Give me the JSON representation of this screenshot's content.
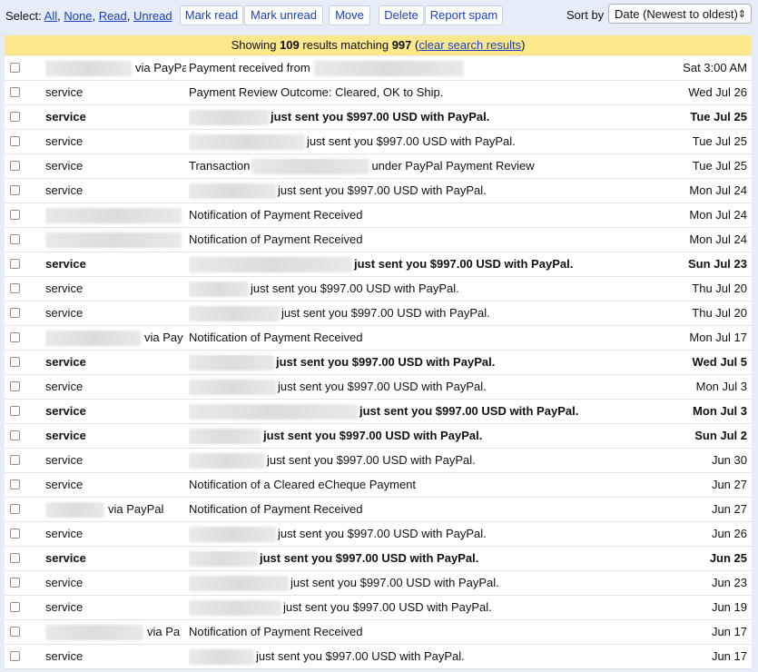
{
  "toolbar": {
    "select_label": "Select:",
    "all": "All",
    "none": "None",
    "read": "Read",
    "unread": "Unread",
    "sep1": ",",
    "sep2": ",",
    "sep3": ",",
    "mark_read": "Mark read",
    "mark_unread": "Mark unread",
    "move": "Move",
    "delete": "Delete",
    "report_spam": "Report spam",
    "sort_label": "Sort by",
    "sort_value": "Date (Newest to oldest)",
    "sort_arrow": "⇕"
  },
  "banner": {
    "showing": "Showing",
    "count": "109",
    "results_matching": "results matching",
    "query": "997",
    "open_paren": "(",
    "clear_link": "clear search results",
    "close_paren": ")"
  },
  "messages": [
    {
      "sender": "via PayPa",
      "subject": "Payment received from",
      "date": "Sat 3:00 AM",
      "bold": false
    },
    {
      "sender": "service",
      "subject": "Payment Review Outcome: Cleared, OK to Ship.",
      "date": "Wed Jul 26",
      "bold": false
    },
    {
      "sender": "service",
      "subject": "just sent you $997.00 USD with PayPal.",
      "date": "Tue Jul 25",
      "bold": true
    },
    {
      "sender": "service",
      "subject": "just sent you $997.00 USD with PayPal.",
      "date": "Tue Jul 25",
      "bold": false
    },
    {
      "sender": "service",
      "subject": "Transaction",
      "subject_after": "under PayPal Payment Review",
      "date": "Tue Jul 25",
      "bold": false
    },
    {
      "sender": "service",
      "subject": "just sent you $997.00 USD with PayPal.",
      "date": "Mon Jul 24",
      "bold": false
    },
    {
      "sender": "",
      "subject": "Notification of Payment Received",
      "date": "Mon Jul 24",
      "bold": false
    },
    {
      "sender": "",
      "subject": "Notification of Payment Received",
      "date": "Mon Jul 24",
      "bold": false
    },
    {
      "sender": "service",
      "subject": "just sent you $997.00 USD with PayPal.",
      "date": "Sun Jul 23",
      "bold": true
    },
    {
      "sender": "service",
      "subject": "just sent you $997.00 USD with PayPal.",
      "date": "Thu Jul 20",
      "bold": false
    },
    {
      "sender": "service",
      "subject": "just sent you $997.00 USD with PayPal.",
      "date": "Thu Jul 20",
      "bold": false
    },
    {
      "sender": "via Pay",
      "subject": "Notification of Payment Received",
      "date": "Mon Jul 17",
      "bold": false
    },
    {
      "sender": "service",
      "subject": "just sent you $997.00 USD with PayPal.",
      "date": "Wed Jul 5",
      "bold": true
    },
    {
      "sender": "service",
      "subject": "just sent you $997.00 USD with PayPal.",
      "date": "Mon Jul 3",
      "bold": false
    },
    {
      "sender": "service",
      "subject": "just sent you $997.00 USD with PayPal.",
      "date": "Mon Jul 3",
      "bold": true
    },
    {
      "sender": "service",
      "subject": "just sent you $997.00 USD with PayPal.",
      "date": "Sun Jul 2",
      "bold": true
    },
    {
      "sender": "service",
      "subject": "just sent you $997.00 USD with PayPal.",
      "date": "Jun 30",
      "bold": false
    },
    {
      "sender": "service",
      "subject": "Notification of a Cleared eCheque Payment",
      "date": "Jun 27",
      "bold": false
    },
    {
      "sender": "via PayPal",
      "subject": "Notification of Payment Received",
      "date": "Jun 27",
      "bold": false
    },
    {
      "sender": "service",
      "subject": "just sent you $997.00 USD with PayPal.",
      "date": "Jun 26",
      "bold": false
    },
    {
      "sender": "service",
      "subject": "just sent you $997.00 USD with PayPal.",
      "date": "Jun 25",
      "bold": true
    },
    {
      "sender": "service",
      "subject": "just sent you $997.00 USD with PayPal.",
      "date": "Jun 23",
      "bold": false
    },
    {
      "sender": "service",
      "subject": "just sent you $997.00 USD with PayPal.",
      "date": "Jun 19",
      "bold": false
    },
    {
      "sender": "via Pa",
      "subject": "Notification of Payment Received",
      "date": "Jun 17",
      "bold": false
    },
    {
      "sender": "service",
      "subject": "just sent you $997.00 USD with PayPal.",
      "date": "Jun 17",
      "bold": false
    }
  ]
}
